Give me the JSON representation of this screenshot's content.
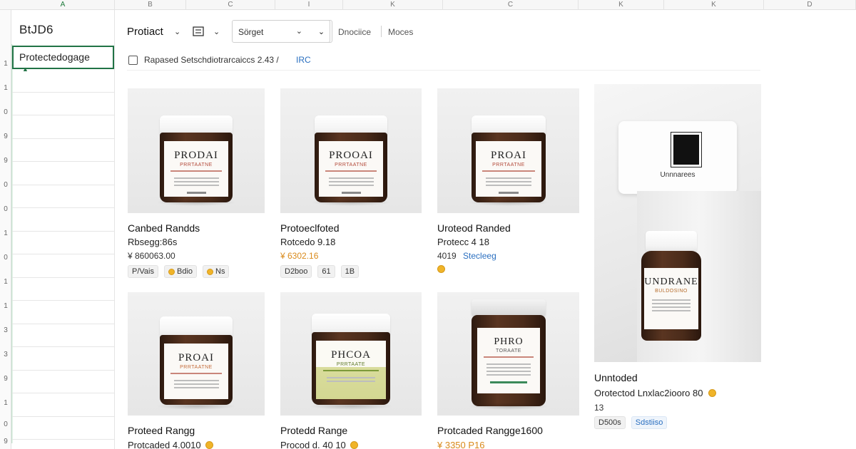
{
  "columns": [
    {
      "label": "A",
      "active": true
    },
    {
      "label": "B"
    },
    {
      "label": "C"
    },
    {
      "label": "I"
    },
    {
      "label": "K"
    },
    {
      "label": "C"
    },
    {
      "label": "K"
    },
    {
      "label": "K"
    },
    {
      "label": "D"
    }
  ],
  "rows": [
    "1",
    "1",
    "0",
    "9",
    "9",
    "0",
    "0",
    "1",
    "0",
    "1",
    "1",
    "3",
    "3",
    "9",
    "1",
    "0",
    "9"
  ],
  "sheet": {
    "name_box": "BtJD6",
    "selected_cell": "Protectedogage"
  },
  "toolbar": {
    "title": "Protiact",
    "sort_label": "Sörget",
    "link1": "Dnociice",
    "link2": "Moces"
  },
  "filter": {
    "text": "Rapased Setschdiotrarcaiccs 2.43 /",
    "link": "IRC"
  },
  "products": [
    {
      "title": "Canbed Randds",
      "sub": "Rbsegg:86s",
      "price": "¥ 860063.00",
      "jar_brand": "PRODAI",
      "jar_sub": "PRRTAATNE",
      "tags": [
        {
          "text": "P/Vais"
        },
        {
          "text": "Bdio",
          "coin": true
        },
        {
          "text": "Ns",
          "coin": true
        }
      ]
    },
    {
      "title": "Protoeclfoted",
      "sub": "Rotcedo 9.18",
      "price": "¥ 6302.16",
      "jar_brand": "PROOAI",
      "jar_sub": "PRRTAATNE",
      "tags": [
        {
          "text": "D2boo"
        },
        {
          "text": "61"
        },
        {
          "text": "1B"
        }
      ]
    },
    {
      "title": "Uroteod Randed",
      "sub": "Protecc 4 18",
      "price": "4019",
      "price_link": "Stecleeg",
      "jar_brand": "PROAI",
      "jar_sub": "PRRTAATNE",
      "tags": [
        {
          "coin": true
        }
      ]
    },
    {
      "title": "Unntoded",
      "sub": "Orotectod Lnxlac2iooro 80",
      "price": "13",
      "jar_brand": "UNDRANE",
      "jar_sub": "BULDOSINO",
      "box_label": "Unnnarees",
      "tags": [
        {
          "text": "D500s"
        },
        {
          "text": "Sdstiiso",
          "blue": true
        }
      ]
    },
    {
      "title": "Proteed Rangg",
      "sub": "Protcaded 4.0010",
      "jar_brand": "PROAI",
      "jar_sub": "PRRTAATNE",
      "tags": []
    },
    {
      "title": "Protedd Range",
      "sub": "Procod d. 40 10",
      "jar_brand": "PHCOA",
      "jar_sub": "PRRTAATE",
      "tags": []
    },
    {
      "title": "Protcaded Rangge1600",
      "sub": "¥ 3350 P16",
      "jar_brand": "PHRO",
      "jar_sub": "TORAATE",
      "tags": []
    }
  ],
  "colors": {
    "excel_green": "#217346",
    "accent_orange": "#d98a1b",
    "link_blue": "#2a6fc0"
  },
  "icons": [
    "list-view-icon",
    "chevron-down-icon",
    "checkbox-icon",
    "coin-icon"
  ]
}
